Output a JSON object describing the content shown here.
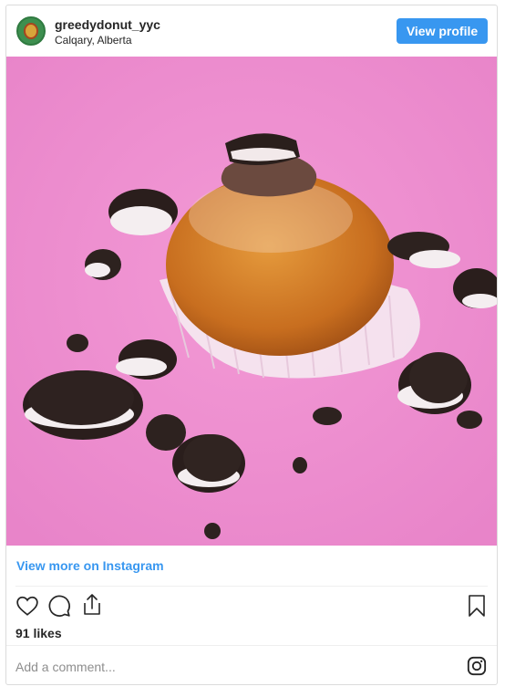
{
  "header": {
    "username": "greedydonut_yyc",
    "location": "Calqary, Alberta",
    "view_profile_label": "View profile"
  },
  "post": {
    "image_description": "",
    "view_more_label": "View more on Instagram",
    "likes_text": "91 likes"
  },
  "actions": {
    "icons": [
      "heart-icon",
      "comment-icon",
      "share-icon",
      "bookmark-icon"
    ]
  },
  "comment": {
    "placeholder": "Add a comment..."
  },
  "colors": {
    "accent": "#3897f0",
    "photo_background": "#ee8fd1",
    "border": "#dbdbdb"
  }
}
